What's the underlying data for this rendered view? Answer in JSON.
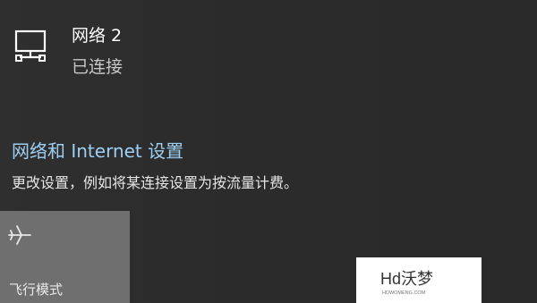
{
  "network": {
    "name": "网络 2",
    "status": "已连接",
    "icon": "ethernet-monitor-icon"
  },
  "settings": {
    "link_label": "网络和 Internet 设置",
    "description": "更改设置，例如将某连接设置为按流量计费。"
  },
  "quick_actions": {
    "airplane_mode": {
      "label": "飞行模式",
      "icon": "airplane-icon"
    }
  },
  "watermark": {
    "brand": "Hd沃梦",
    "site": "HDWOMENG.COM"
  },
  "colors": {
    "background": "#2b2b2b",
    "link": "#9ccff3",
    "tile": "#6f6f6f"
  }
}
